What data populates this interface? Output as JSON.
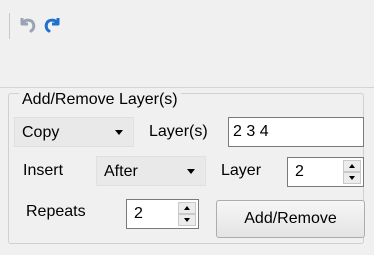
{
  "toolbar": {
    "undo_icon": "undo-icon",
    "redo_icon": "redo-icon"
  },
  "group": {
    "legend": "Add/Remove Layer(s)",
    "mode": {
      "selected": "Copy"
    },
    "layers_label": "Layer(s)",
    "layers_value": "2 3 4",
    "insert_label": "Insert",
    "insert_position": {
      "selected": "After"
    },
    "layer_label": "Layer",
    "layer_value": "2",
    "repeats_label": "Repeats",
    "repeats_value": "2",
    "add_remove_label": "Add/Remove"
  },
  "colors": {
    "undo_disabled": "#9aa3b3",
    "redo_accent": "#1e6fd0"
  }
}
